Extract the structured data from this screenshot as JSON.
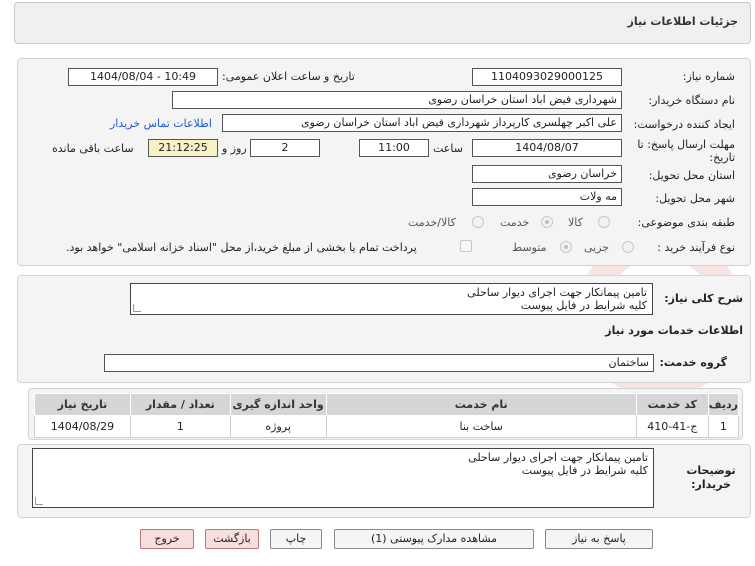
{
  "header": {
    "title": "جزئیات اطلاعات نیاز"
  },
  "labels": {
    "need_number": "شماره نیاز:",
    "announce_datetime": "تاریخ و ساعت اعلان عمومی:",
    "buyer_org": "نام دستگاه خریدار:",
    "requester": "ایجاد کننده درخواست:",
    "contact_link": "اطلاعات تماس خریدار",
    "deadline": "مهلت ارسال پاسخ: تا تاریخ:",
    "hour": "ساعت",
    "day_and": "روز و",
    "remaining": "ساعت باقی مانده",
    "province": "استان محل تحویل:",
    "city": "شهر محل تحویل:",
    "category": "طبقه بندی موضوعی:",
    "process_type": "نوع فرآیند خرید :",
    "need_summary": "شرح کلی نیاز:",
    "services_info": "اطلاعات خدمات مورد نیاز",
    "service_group": "گروه خدمت:",
    "buyer_notes": "توضیحات خریدار:"
  },
  "fields": {
    "need_number": "1104093029000125",
    "announce_datetime": "1404/08/04 - 10:49",
    "buyer_org": "شهرداری فیض اباد استان خراسان رضوی",
    "requester": "علی اکبر چهلسری کارپرداز شهرداری فیض اباد استان خراسان رضوی",
    "deadline_date": "1404/08/07",
    "deadline_time": "11:00",
    "days": "2",
    "remaining_time": "21:12:25",
    "province": "خراسان رضوی",
    "city": "مه ولات",
    "service_group": "ساختمان"
  },
  "category_options": [
    "کالا",
    "خدمت",
    "کالا/خدمت"
  ],
  "process_options": [
    "جزیی",
    "متوسط"
  ],
  "payment_note": "پرداخت تمام یا بخشی از مبلغ خرید،از محل \"اسناد خزانه اسلامی\" خواهد بود.",
  "need_summary_lines": [
    "تامین پیمانکار جهت اجرای دیوار ساحلی",
    "کلیه شرایط در فایل پیوست"
  ],
  "buyer_notes_lines": [
    "تامین پیمانکار جهت اجرای دیوار ساحلی",
    "کلیه شرایط در فایل پیوست"
  ],
  "table": {
    "headers": [
      "ردیف",
      "کد خدمت",
      "نام خدمت",
      "واحد اندازه گیری",
      "تعداد / مقدار",
      "تاریخ نیاز"
    ],
    "rows": [
      [
        "1",
        "ج-41-410",
        "ساخت بنا",
        "پروژه",
        "1",
        "1404/08/29"
      ]
    ]
  },
  "buttons": {
    "reply": "پاسخ به نیاز",
    "attachments": "مشاهده مدارک پیوستی (1)",
    "print": "چاپ",
    "back": "بازگشت",
    "exit": "خروج"
  },
  "colors": {
    "link": "#1a5bd6",
    "remaining_bg": "#f6f2c6",
    "exit_bg": "#f9dede"
  }
}
